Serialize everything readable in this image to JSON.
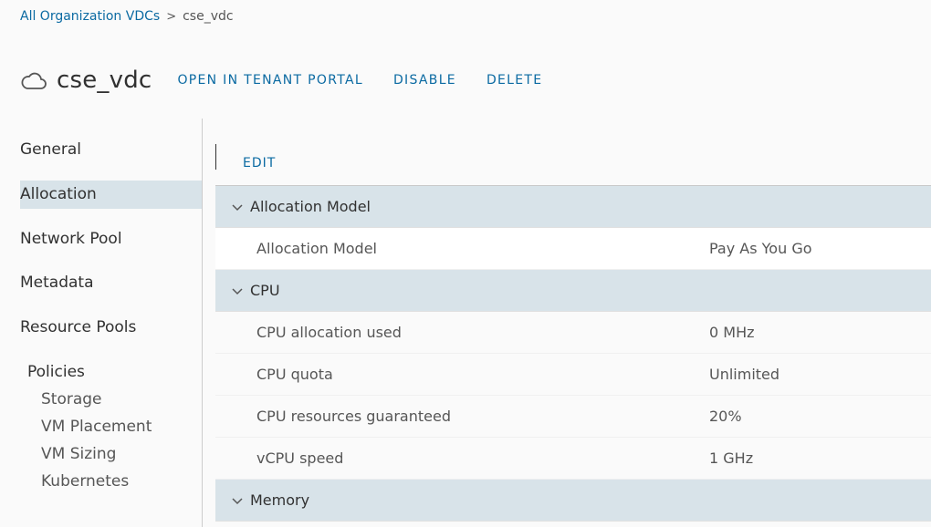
{
  "breadcrumb": {
    "root": "All Organization VDCs",
    "separator": ">",
    "current": "cse_vdc"
  },
  "header": {
    "title": "cse_vdc",
    "actions": [
      "OPEN IN TENANT PORTAL",
      "DISABLE",
      "DELETE"
    ]
  },
  "sidenav": {
    "items": [
      "General",
      "Allocation",
      "Network Pool",
      "Metadata",
      "Resource Pools"
    ],
    "active": "Allocation",
    "group": "Policies",
    "subitems": [
      "Storage",
      "VM Placement",
      "VM Sizing",
      "Kubernetes"
    ]
  },
  "toolbar": {
    "edit": "EDIT"
  },
  "sections": {
    "allocation_model": {
      "title": "Allocation Model",
      "rows": [
        {
          "key": "Allocation Model",
          "value": "Pay As You Go"
        }
      ]
    },
    "cpu": {
      "title": "CPU",
      "rows": [
        {
          "key": "CPU allocation used",
          "value": "0 MHz"
        },
        {
          "key": "CPU quota",
          "value": "Unlimited"
        },
        {
          "key": "CPU resources guaranteed",
          "value": "20%"
        },
        {
          "key": "vCPU speed",
          "value": "1 GHz"
        }
      ]
    },
    "memory": {
      "title": "Memory"
    }
  },
  "colors": {
    "link": "#0b6aa2",
    "section_bg": "#d8e3e9",
    "text": "#313131"
  },
  "icons": {
    "vdc": "cloud-icon",
    "section_toggle": "chevron-down-icon"
  }
}
